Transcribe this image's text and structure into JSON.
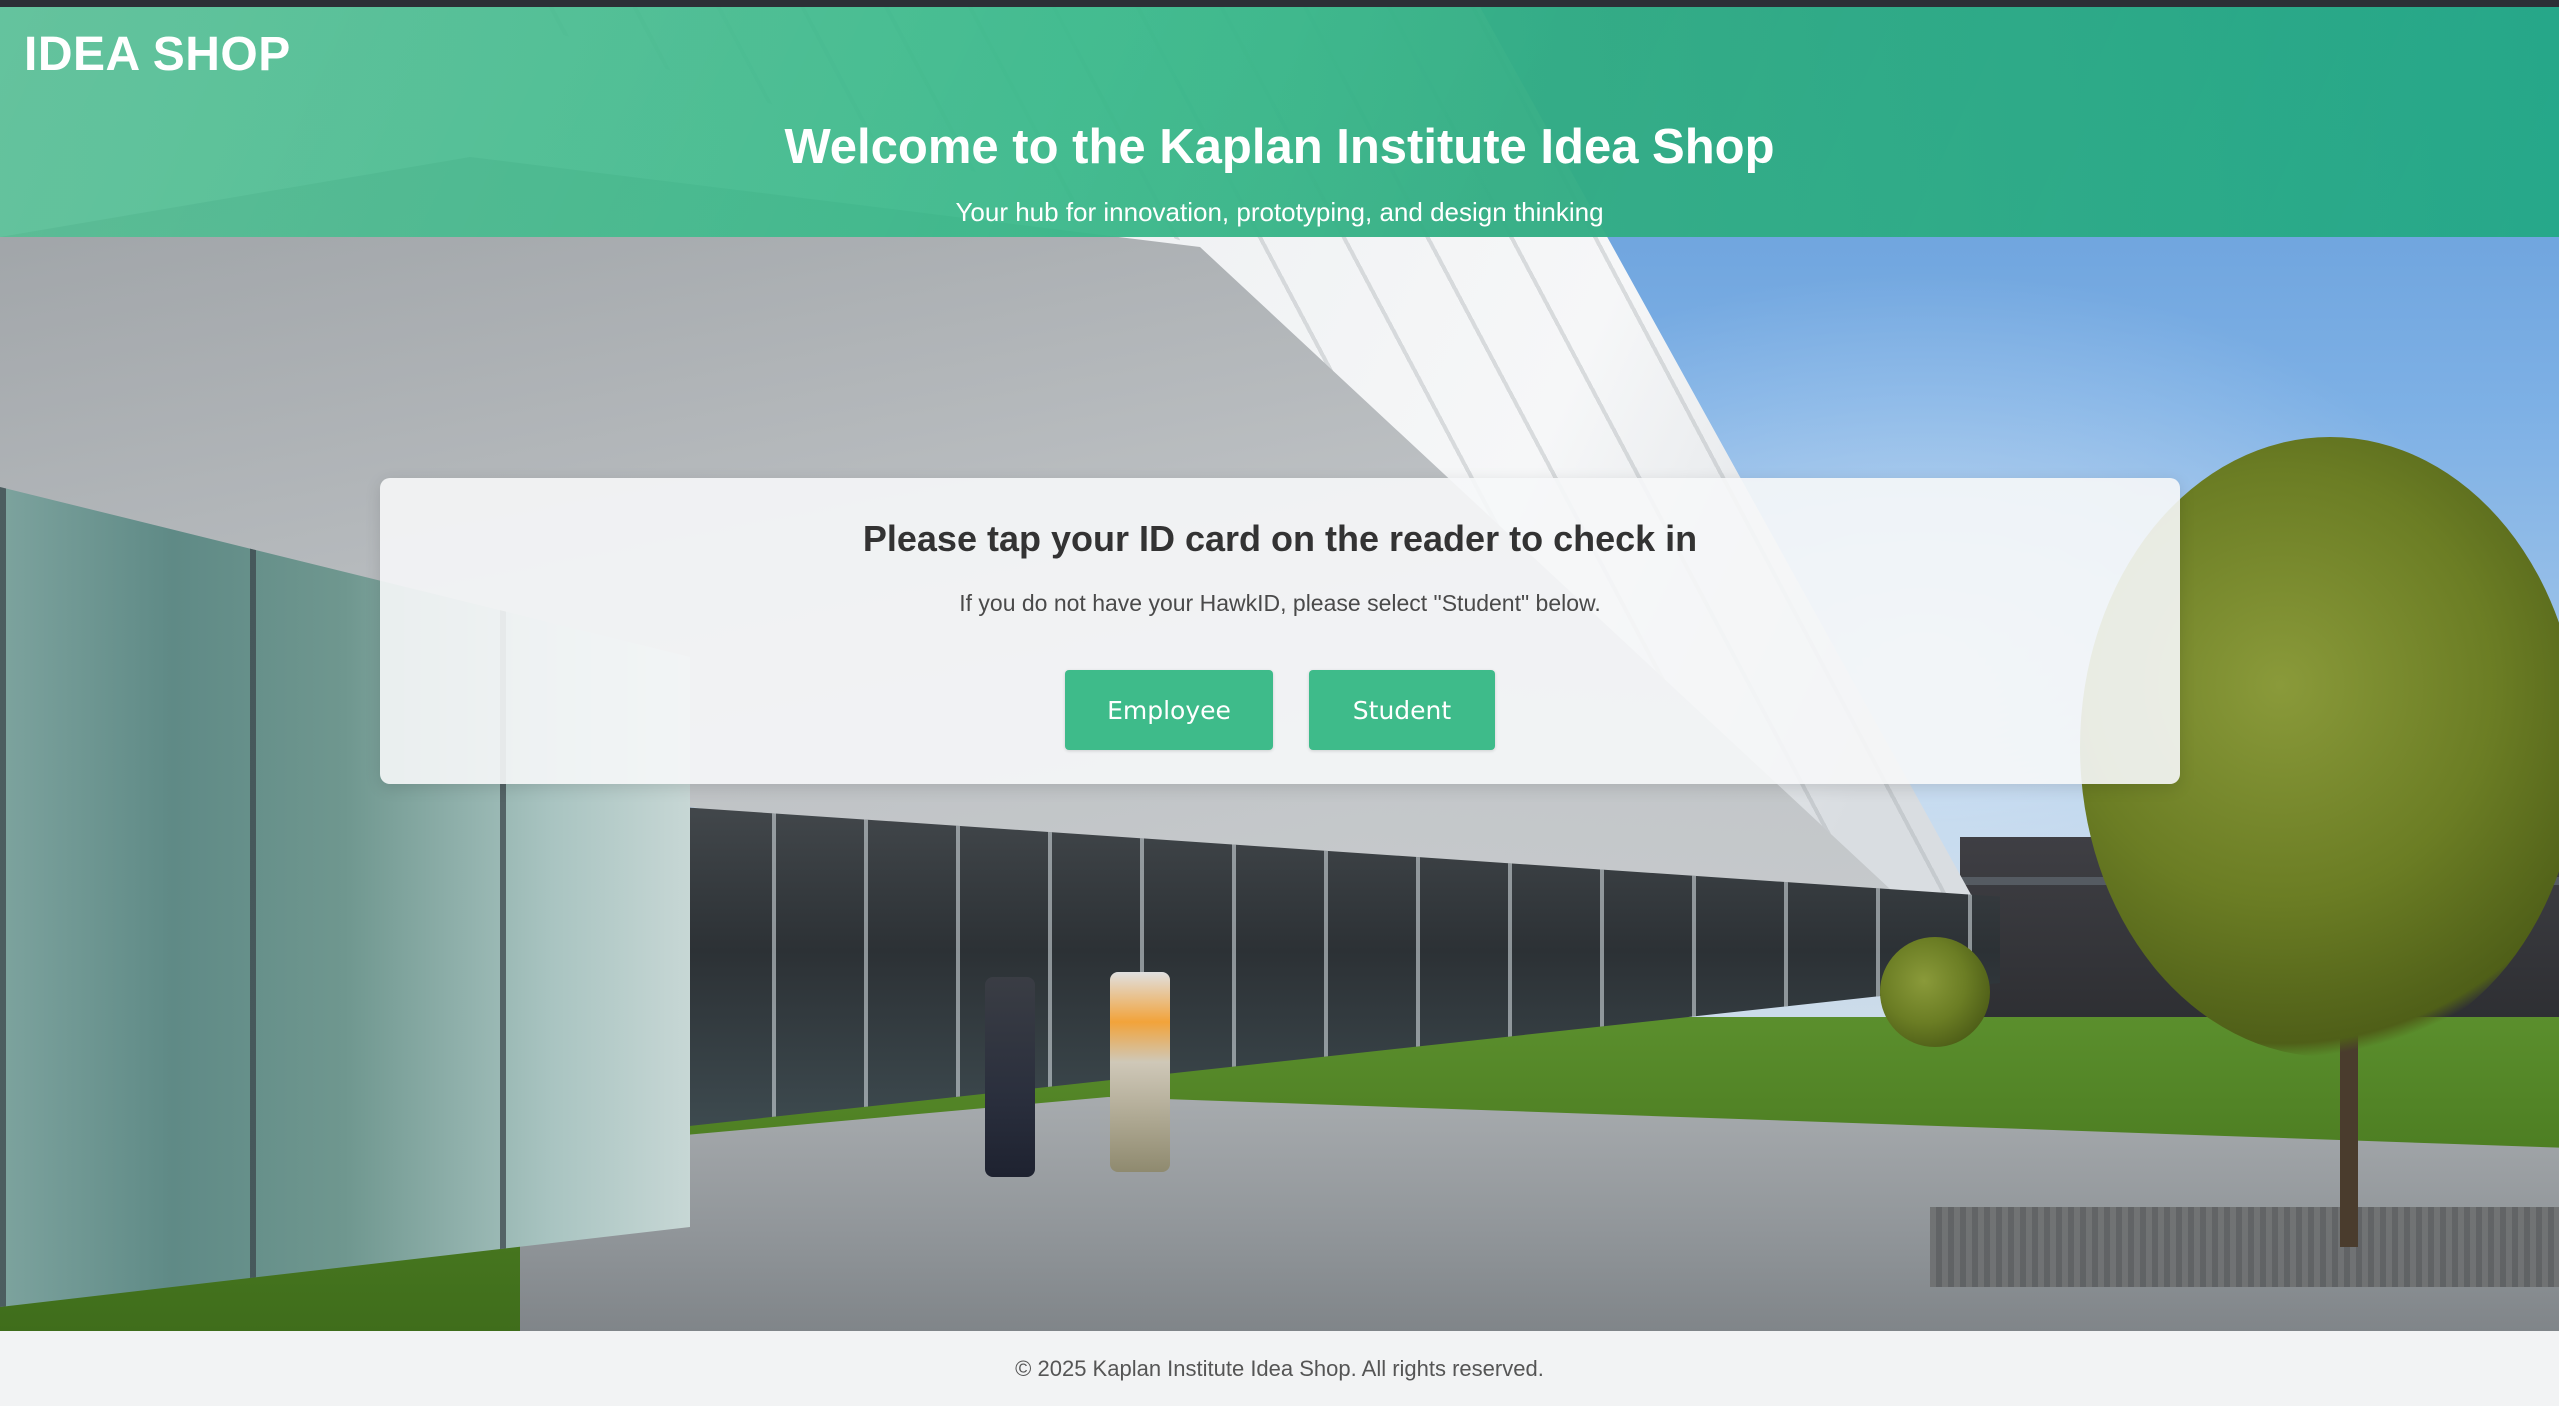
{
  "brand": "IDEA SHOP",
  "hero": {
    "title": "Welcome to the Kaplan Institute Idea Shop",
    "subtitle": "Your hub for innovation, prototyping, and design thinking"
  },
  "checkin": {
    "title": "Please tap your ID card on the reader to check in",
    "note": "If you do not have your HawkID, please select \"Student\" below.",
    "buttons": {
      "employee": "Employee",
      "student": "Student"
    }
  },
  "footer": {
    "copyright": "© 2025 Kaplan Institute Idea Shop. All rights reserved."
  },
  "colors": {
    "header_green": "#3aba8c",
    "button_green": "#3ebb8a",
    "text_dark": "#333333",
    "footer_bg": "#f2f3f4"
  }
}
